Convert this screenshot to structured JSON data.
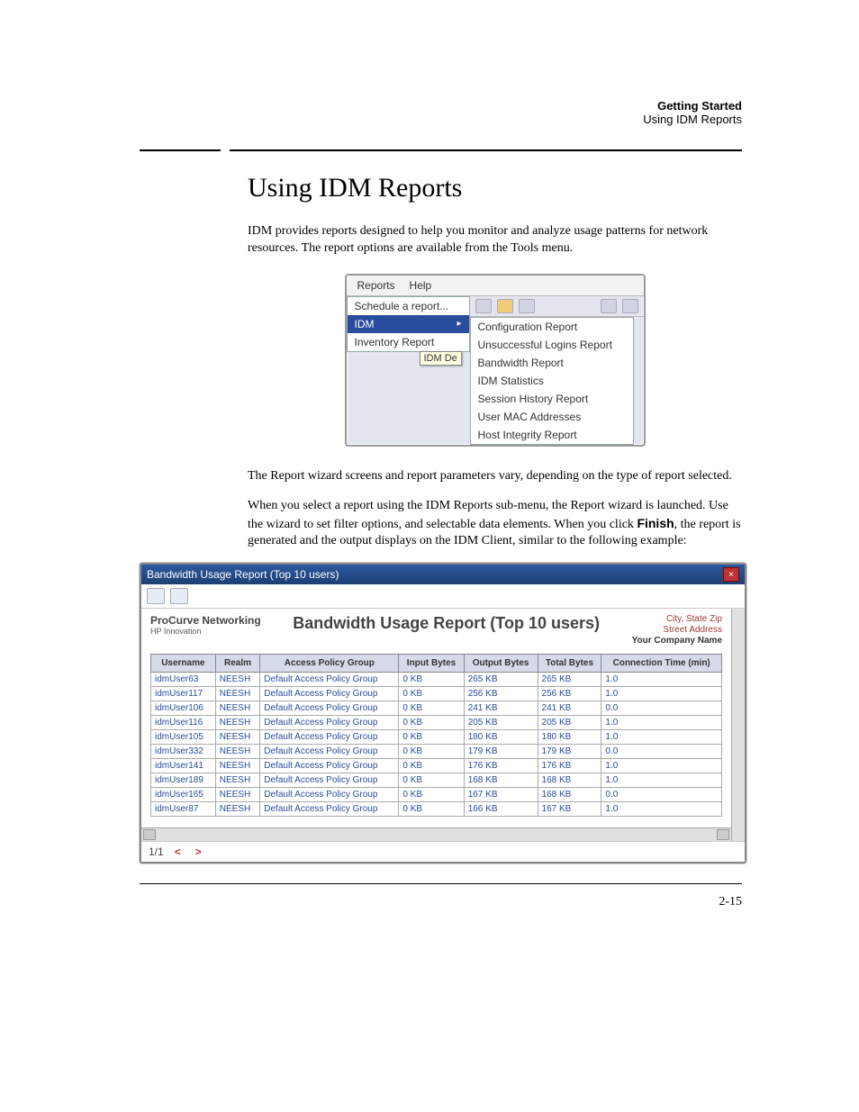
{
  "header": {
    "title": "Getting Started",
    "subtitle": "Using IDM Reports"
  },
  "section_title": "Using IDM Reports",
  "para1": "IDM provides reports designed to help you monitor and analyze usage patterns for network resources. The report options are available from the Tools menu.",
  "fig1": {
    "menubar": [
      "Reports",
      "Help"
    ],
    "menu": {
      "items": [
        "Schedule a report...",
        "IDM",
        "Inventory Report"
      ],
      "highlighted_index": 1,
      "tooltip": "IDM De"
    },
    "submenu": [
      "Configuration Report",
      "Unsuccessful Logins Report",
      "Bandwidth Report",
      "IDM Statistics",
      "Session History Report",
      "User MAC Addresses",
      "Host Integrity Report"
    ]
  },
  "para2": "The Report wizard screens and report parameters vary, depending on the type of report selected.",
  "para3_pre": "When you select a report using the IDM Reports sub-menu, the Report wizard is launched. Use the wizard to set filter options, and selectable data elements. When you click ",
  "para3_bold": "Finish",
  "para3_post": ", the report is generated and the output displays on the IDM Client, similar to the following example:",
  "report": {
    "window_title": "Bandwidth Usage Report (Top 10 users)",
    "brand_line1": "ProCurve Networking",
    "brand_line2": "HP Innovation",
    "title": "Bandwidth Usage Report (Top 10 users)",
    "meta": {
      "line1": "City, State Zip",
      "line2": "Street Address",
      "line3": "Your Company Name"
    },
    "columns": [
      "Username",
      "Realm",
      "Access Policy Group",
      "Input Bytes",
      "Output Bytes",
      "Total Bytes",
      "Connection Time (min)"
    ],
    "rows": [
      [
        "idmUser63",
        "NEESH",
        "Default Access Policy Group",
        "0 KB",
        "265 KB",
        "265 KB",
        "1.0"
      ],
      [
        "idmUser117",
        "NEESH",
        "Default Access Policy Group",
        "0 KB",
        "256 KB",
        "256 KB",
        "1.0"
      ],
      [
        "idmUser106",
        "NEESH",
        "Default Access Policy Group",
        "0 KB",
        "241 KB",
        "241 KB",
        "0.0"
      ],
      [
        "idmUser116",
        "NEESH",
        "Default Access Policy Group",
        "0 KB",
        "205 KB",
        "205 KB",
        "1.0"
      ],
      [
        "idmUser105",
        "NEESH",
        "Default Access Policy Group",
        "0 KB",
        "180 KB",
        "180 KB",
        "1.0"
      ],
      [
        "idmUser332",
        "NEESH",
        "Default Access Policy Group",
        "0 KB",
        "179 KB",
        "179 KB",
        "0.0"
      ],
      [
        "idmUser141",
        "NEESH",
        "Default Access Policy Group",
        "0 KB",
        "176 KB",
        "176 KB",
        "1.0"
      ],
      [
        "idmUser189",
        "NEESH",
        "Default Access Policy Group",
        "0 KB",
        "168 KB",
        "168 KB",
        "1.0"
      ],
      [
        "idmUser165",
        "NEESH",
        "Default Access Policy Group",
        "0 KB",
        "167 KB",
        "168 KB",
        "0.0"
      ],
      [
        "idmUser87",
        "NEESH",
        "Default Access Policy Group",
        "0 KB",
        "166 KB",
        "167 KB",
        "1.0"
      ]
    ],
    "footer": {
      "page_indicator": "1/1",
      "prev": "<",
      "next": ">"
    }
  },
  "page_number": "2-15"
}
